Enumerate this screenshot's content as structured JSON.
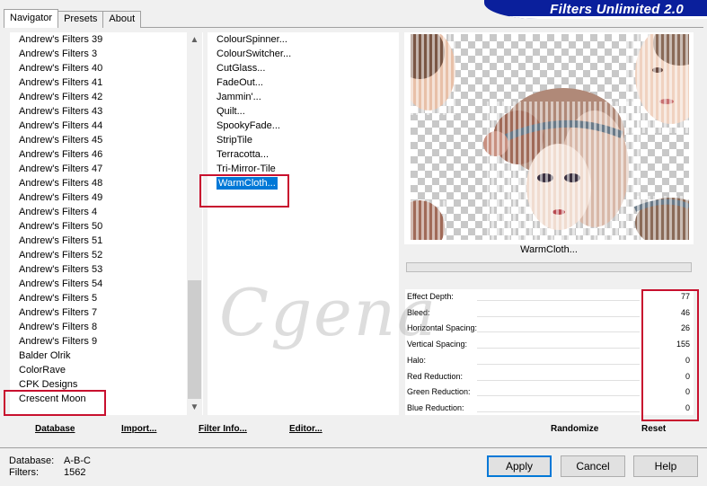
{
  "app": {
    "brand_title": "Filters Unlimited 2.0"
  },
  "tabs": [
    {
      "label": "Navigator",
      "active": true
    },
    {
      "label": "Presets",
      "active": false
    },
    {
      "label": "About",
      "active": false
    }
  ],
  "categories": {
    "items": [
      "Andrew's Filters 39",
      "Andrew's Filters 3",
      "Andrew's Filters 40",
      "Andrew's Filters 41",
      "Andrew's Filters 42",
      "Andrew's Filters 43",
      "Andrew's Filters 44",
      "Andrew's Filters 45",
      "Andrew's Filters 46",
      "Andrew's Filters 47",
      "Andrew's Filters 48",
      "Andrew's Filters 49",
      "Andrew's Filters 4",
      "Andrew's Filters 50",
      "Andrew's Filters 51",
      "Andrew's Filters 52",
      "Andrew's Filters 53",
      "Andrew's Filters 54",
      "Andrew's Filters 5",
      "Andrew's Filters 7",
      "Andrew's Filters 8",
      "Andrew's Filters 9",
      "Balder Olrik",
      "ColorRave",
      "CPK Designs",
      "Crescent Moon"
    ],
    "highlighted": "Crescent Moon"
  },
  "filters": {
    "items": [
      "ColourSpinner...",
      "ColourSwitcher...",
      "CutGlass...",
      "FadeOut...",
      "Jammin'...",
      "Quilt...",
      "SpookyFade...",
      "StripTile",
      "Terracotta...",
      "Tri-Mirror-Tile",
      "WarmCloth..."
    ],
    "selected": "WarmCloth..."
  },
  "preview": {
    "label": "WarmCloth..."
  },
  "params": [
    {
      "name": "Effect Depth:",
      "value": "77"
    },
    {
      "name": "Bleed:",
      "value": "46"
    },
    {
      "name": "Horizontal Spacing:",
      "value": "26"
    },
    {
      "name": "Vertical Spacing:",
      "value": "155"
    },
    {
      "name": "Halo:",
      "value": "0"
    },
    {
      "name": "Red Reduction:",
      "value": "0"
    },
    {
      "name": "Green Reduction:",
      "value": "0"
    },
    {
      "name": "Blue Reduction:",
      "value": "0"
    }
  ],
  "left_buttons": {
    "database": "Database",
    "import": "Import...",
    "filter_info": "Filter Info...",
    "editor": "Editor..."
  },
  "right_buttons": {
    "randomize": "Randomize",
    "reset": "Reset"
  },
  "info": {
    "database_label": "Database:",
    "database_value": "A-B-C",
    "filters_label": "Filters:",
    "filters_value": "1562"
  },
  "dialog_buttons": {
    "apply": "Apply",
    "cancel": "Cancel",
    "help": "Help"
  },
  "watermark": "Cgena",
  "colors": {
    "selection": "#0078d7",
    "brand": "#0a1f9c",
    "highlight_box": "#c8102e"
  }
}
